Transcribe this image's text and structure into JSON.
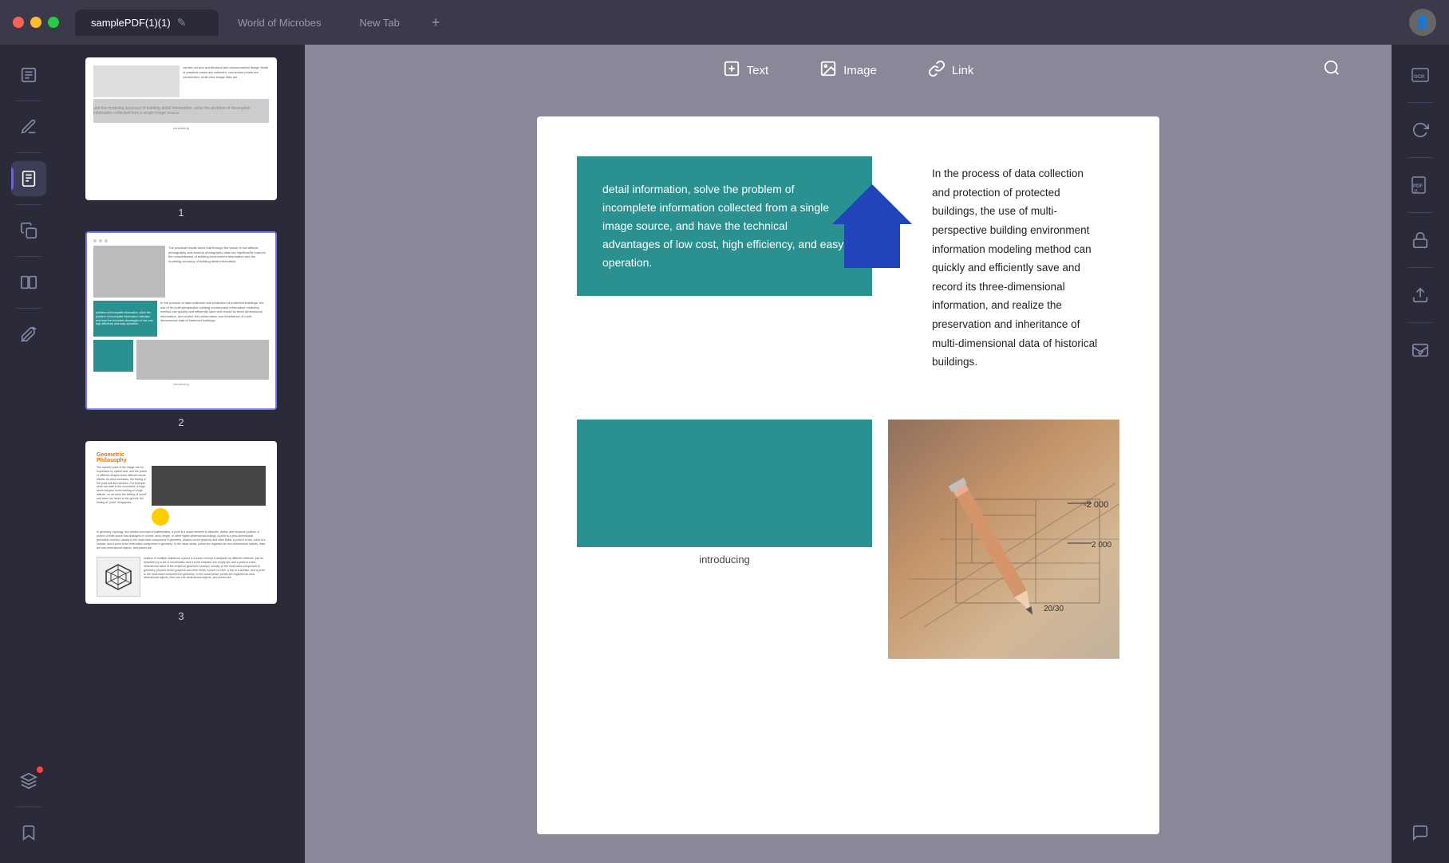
{
  "titleBar": {
    "activeTab": "samplePDF(1)(1)",
    "tab2": "World of Microbes",
    "tab3": "New Tab",
    "newTabIcon": "+"
  },
  "toolbar": {
    "textLabel": "Text",
    "imageLabel": "Image",
    "linkLabel": "Link"
  },
  "thumbnails": [
    {
      "number": "1"
    },
    {
      "number": "2"
    },
    {
      "number": "3"
    }
  ],
  "pageContent": {
    "tealBoxText": "detail information, solve the problem of incomplete information collected from a single image source, and have the technical advantages of low cost, high efficiency, and easy operation.",
    "rightText": "In the process of data collection and protection of protected buildings, the use of multi-perspective building environment information modeling method can quickly and efficiently save and record its three-dimensional information, and realize the preservation and inheritance of multi-dimensional data of historical buildings.",
    "introducingLabel": "introducing"
  },
  "rightSidebar": {
    "icons": [
      "ocr",
      "refresh",
      "pdf-a",
      "lock",
      "share",
      "mail"
    ]
  }
}
